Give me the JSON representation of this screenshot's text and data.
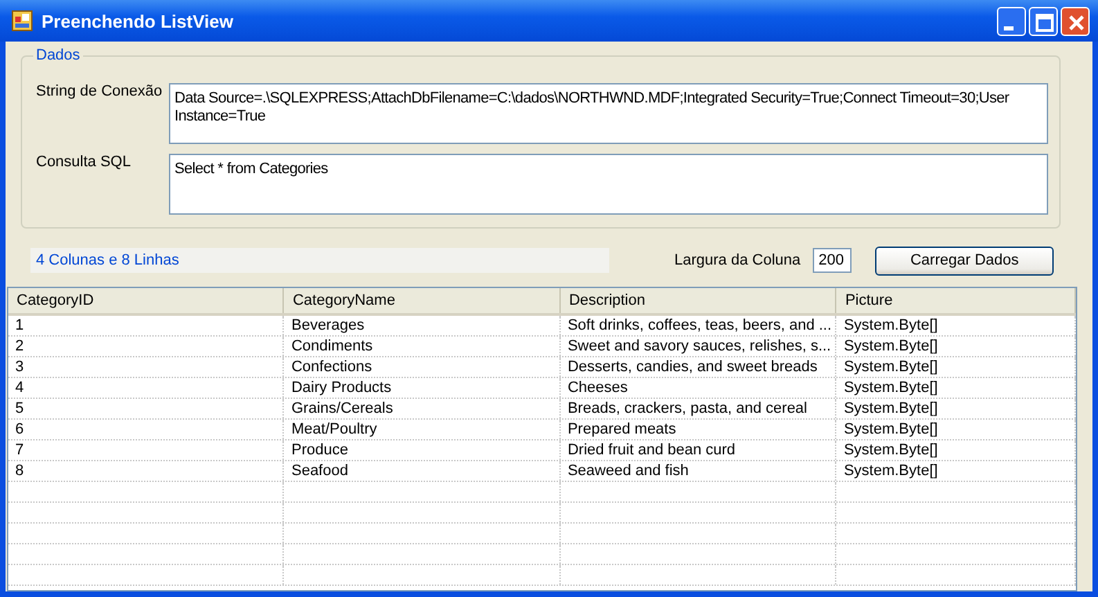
{
  "window": {
    "title": "Preenchendo ListView"
  },
  "group": {
    "title": "Dados",
    "fields": [
      {
        "label": "String de Conexão",
        "value": "Data Source=.\\SQLEXPRESS;AttachDbFilename=C:\\dados\\NORTHWND.MDF;Integrated Security=True;Connect Timeout=30;User Instance=True"
      },
      {
        "label": "Consulta SQL",
        "value": "Select * from Categories"
      }
    ]
  },
  "status": "4 Colunas e 8 Linhas",
  "column_width": {
    "label": "Largura da Coluna",
    "value": "200"
  },
  "load_button": "Carregar Dados",
  "table": {
    "columns": [
      "CategoryID",
      "CategoryName",
      "Description",
      "Picture"
    ],
    "rows": [
      [
        "1",
        "Beverages",
        "Soft drinks, coffees, teas, beers, and ...",
        "System.Byte[]"
      ],
      [
        "2",
        "Condiments",
        "Sweet and savory sauces, relishes, s...",
        "System.Byte[]"
      ],
      [
        "3",
        "Confections",
        "Desserts, candies, and sweet breads",
        "System.Byte[]"
      ],
      [
        "4",
        "Dairy Products",
        "Cheeses",
        "System.Byte[]"
      ],
      [
        "5",
        "Grains/Cereals",
        "Breads, crackers, pasta, and cereal",
        "System.Byte[]"
      ],
      [
        "6",
        "Meat/Poultry",
        "Prepared meats",
        "System.Byte[]"
      ],
      [
        "7",
        "Produce",
        "Dried fruit and bean curd",
        "System.Byte[]"
      ],
      [
        "8",
        "Seafood",
        "Seaweed and fish",
        "System.Byte[]"
      ]
    ]
  }
}
